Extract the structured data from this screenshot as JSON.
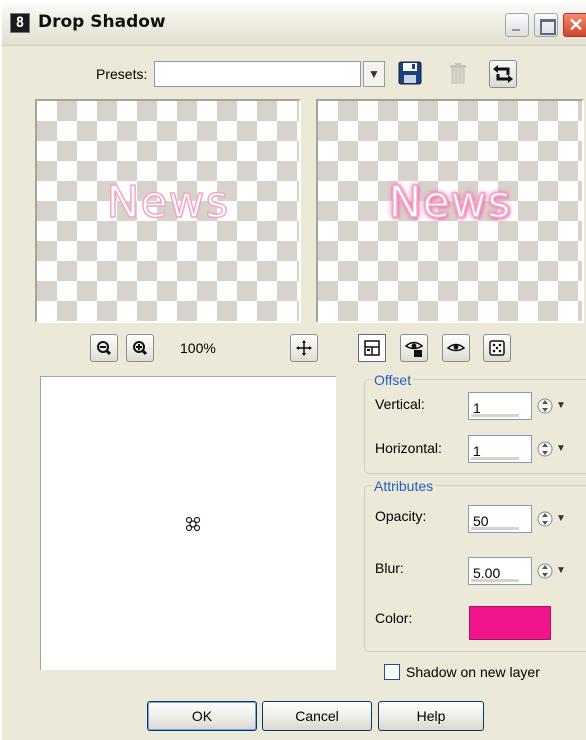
{
  "window": {
    "title": "Drop Shadow",
    "icon_label": "8",
    "close_glyph": "✕"
  },
  "presets": {
    "label": "Presets:",
    "value": "",
    "dropdown_glyph": "▼"
  },
  "preview": {
    "before_text": "News",
    "after_text": "News"
  },
  "zoom": {
    "level": "100%"
  },
  "offset": {
    "group_title": "Offset",
    "vertical_label": "Vertical:",
    "vertical_value": "1",
    "horizontal_label": "Horizontal:",
    "horizontal_value": "1"
  },
  "attributes": {
    "group_title": "Attributes",
    "opacity_label": "Opacity:",
    "opacity_value": "50",
    "blur_label": "Blur:",
    "blur_value": "5.00",
    "color_label": "Color:",
    "color_value": "#f0158c"
  },
  "options": {
    "shadow_new_layer_label": "Shadow on new layer",
    "shadow_new_layer_checked": false
  },
  "buttons": {
    "ok": "OK",
    "cancel": "Cancel",
    "help": "Help"
  },
  "icons": {
    "save": "floppy-disk-icon",
    "delete": "trash-icon",
    "reset": "reset-arrow-icon",
    "zoom_out": "zoom-out-icon",
    "zoom_in": "zoom-in-icon",
    "pan": "move-cross-icon",
    "toggle_preview": "preview-toggle-icon",
    "randomize": "dice-icon"
  }
}
